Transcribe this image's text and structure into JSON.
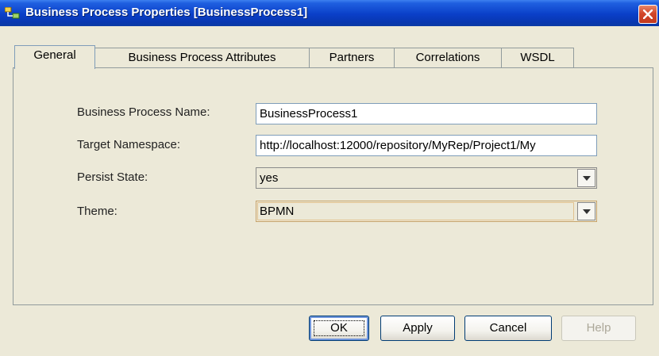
{
  "window": {
    "title": "Business Process Properties [BusinessProcess1]",
    "app_icon": "business-process-icon",
    "close_icon": "close-x-icon"
  },
  "tabs": [
    {
      "label": "General",
      "active": true
    },
    {
      "label": "Business Process Attributes",
      "active": false
    },
    {
      "label": "Partners",
      "active": false
    },
    {
      "label": "Correlations",
      "active": false
    },
    {
      "label": "WSDL",
      "active": false
    }
  ],
  "form": {
    "name_label": "Business Process Name:",
    "name_value": "BusinessProcess1",
    "namespace_label": "Target Namespace:",
    "namespace_value": "http://localhost:12000/repository/MyRep/Project1/My",
    "persist_label": "Persist State:",
    "persist_value": "yes",
    "theme_label": "Theme:",
    "theme_value": "BPMN"
  },
  "buttons": {
    "ok": "OK",
    "apply": "Apply",
    "cancel": "Cancel",
    "help": "Help"
  },
  "colors": {
    "title_bar": "#0a3fc8",
    "close_button": "#d2462a",
    "dialog_bg": "#ece9d8"
  }
}
